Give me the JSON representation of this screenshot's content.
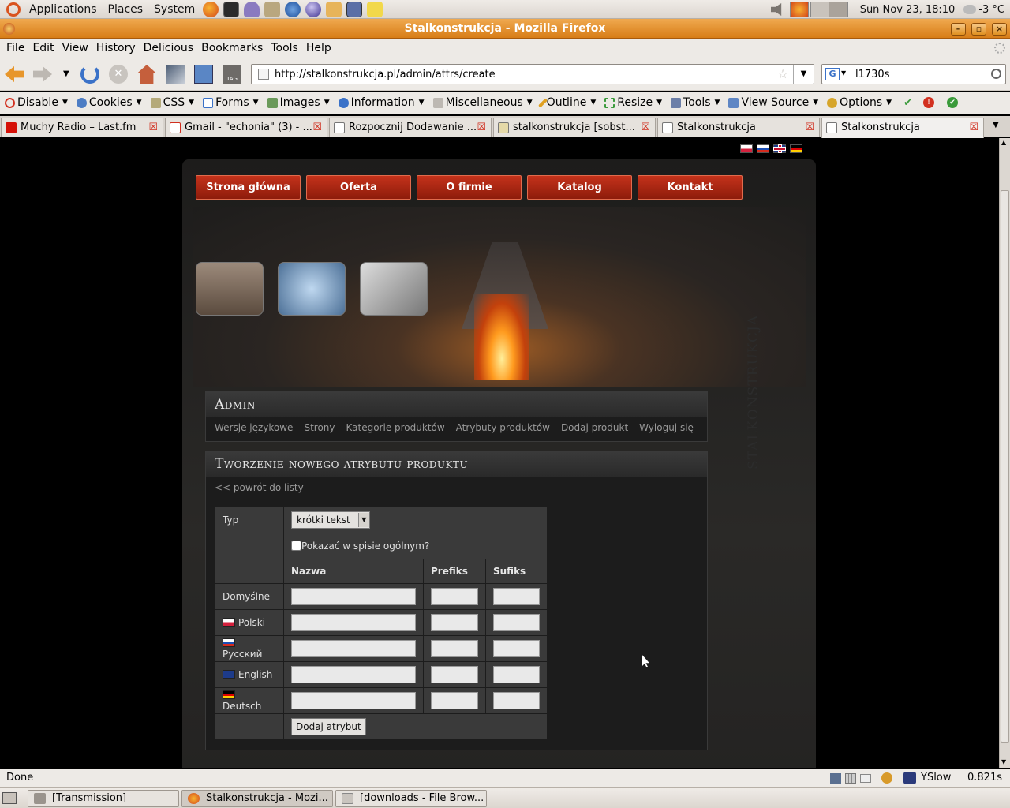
{
  "top_panel": {
    "menus": [
      "Applications",
      "Places",
      "System"
    ],
    "datetime": "Sun Nov 23, 18:10",
    "weather": "-3 °C"
  },
  "window": {
    "title": "Stalkonstrukcja - Mozilla Firefox"
  },
  "menubar": [
    "File",
    "Edit",
    "View",
    "History",
    "Delicious",
    "Bookmarks",
    "Tools",
    "Help"
  ],
  "navbar": {
    "url": "http://stalkonstrukcja.pl/admin/attrs/create",
    "search_value": "l1730s"
  },
  "webdev_toolbar": [
    "Disable",
    "Cookies",
    "CSS",
    "Forms",
    "Images",
    "Information",
    "Miscellaneous",
    "Outline",
    "Resize",
    "Tools",
    "View Source",
    "Options"
  ],
  "tabs": [
    {
      "label": "Muchy Radio – Last.fm"
    },
    {
      "label": "Gmail - \"echonia\" (3) - ..."
    },
    {
      "label": "Rozpocznij Dodawanie ..."
    },
    {
      "label": "stalkonstrukcja [sobst..."
    },
    {
      "label": "Stalkonstrukcja"
    },
    {
      "label": "Stalkonstrukcja"
    }
  ],
  "site": {
    "nav": [
      "Strona główna",
      "Oferta",
      "O firmie",
      "Katalog",
      "Kontakt"
    ],
    "watermark": "STALKONSTRUKCJA",
    "admin": {
      "title": "Admin",
      "links": [
        "Wersje językowe",
        "Strony",
        "Kategorie produktów",
        "Atrybuty produktów",
        "Dodaj produkt",
        "Wyloguj się"
      ]
    },
    "form": {
      "title": "Tworzenie nowego atrybutu produktu",
      "back_link": "<< powrót do listy",
      "type_label": "Typ",
      "type_value": "krótki tekst",
      "show_label": "Pokazać w spisie ogólnym?",
      "columns": [
        "Nazwa",
        "Prefiks",
        "Sufiks"
      ],
      "rows": [
        {
          "label": "Domyślne",
          "flag": ""
        },
        {
          "label": "Polski",
          "flag": "pl"
        },
        {
          "label": "Русский",
          "flag": "ru"
        },
        {
          "label": "English",
          "flag": "gb"
        },
        {
          "label": "Deutsch",
          "flag": "de"
        }
      ],
      "submit": "Dodaj atrybut"
    }
  },
  "statusbar": {
    "text": "Done",
    "yslow": "YSlow",
    "time": "0.821s"
  },
  "taskbar": [
    {
      "label": "[Transmission]"
    },
    {
      "label": "Stalkonstrukcja - Mozi..."
    },
    {
      "label": "[downloads - File Brow..."
    }
  ],
  "colors": {
    "accent_red": "#a52612",
    "panel_bg": "#1c1c1c",
    "title_orange": "#e08d28"
  }
}
